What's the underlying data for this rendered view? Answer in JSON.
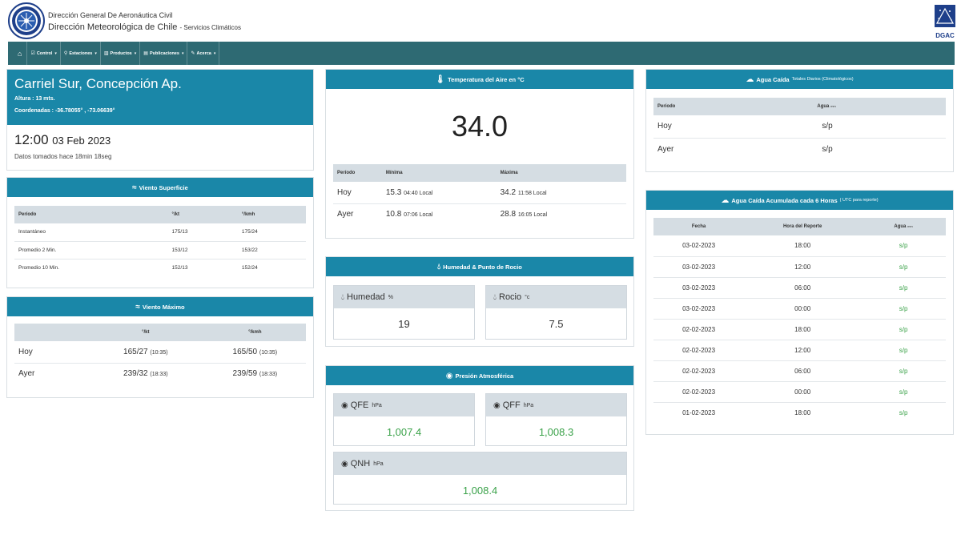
{
  "header": {
    "org_line1": "Dirección General De Aeronáutica Civil",
    "org_line2": "Dirección Meteorológica de Chile",
    "org_line2_sub": "- Servicios Climáticos",
    "right_logo_text": "DGAC"
  },
  "nav": {
    "items": [
      {
        "label": "Control",
        "icon": "checkbox-icon"
      },
      {
        "label": "Estaciones",
        "icon": "map-pin-icon"
      },
      {
        "label": "Productos",
        "icon": "bar-chart-icon"
      },
      {
        "label": "Publicaciones",
        "icon": "document-icon"
      },
      {
        "label": "Acerca",
        "icon": "edit-icon"
      }
    ]
  },
  "station": {
    "name": "Carriel Sur, Concepción Ap.",
    "altura": "Altura : 13 mts.",
    "coords": "Coordenadas : -36.78055° , -73.06639°",
    "time": "12:00",
    "date": "03 Feb 2023",
    "age": "Datos tomados hace 18min 18seg"
  },
  "viento_superficie": {
    "title": "Viento Superficie",
    "headers": [
      "Período",
      "°/kt",
      "°/kmh"
    ],
    "rows": [
      [
        "Instantáneo",
        "175/13",
        "175/24"
      ],
      [
        "Promedio 2 Min.",
        "153/12",
        "153/22"
      ],
      [
        "Promedio 10 Min.",
        "152/13",
        "152/24"
      ]
    ]
  },
  "viento_maximo": {
    "title": "Viento Máximo",
    "headers": [
      "",
      "°/kt",
      "°/kmh"
    ],
    "rows": [
      {
        "label": "Hoy",
        "kt": "165/27",
        "kt_time": "(10:35)",
        "kmh": "165/50",
        "kmh_time": "(10:35)"
      },
      {
        "label": "Ayer",
        "kt": "239/32",
        "kt_time": "(18:33)",
        "kmh": "239/59",
        "kmh_time": "(18:33)"
      }
    ]
  },
  "temperatura": {
    "title": "Temperatura del Aire en °C",
    "current": "34.0",
    "headers": [
      "Período",
      "Mínima",
      "Máxima"
    ],
    "rows": [
      {
        "label": "Hoy",
        "min": "15.3",
        "min_time": "04:40 Local",
        "max": "34.2",
        "max_time": "11:58 Local"
      },
      {
        "label": "Ayer",
        "min": "10.8",
        "min_time": "07:06 Local",
        "max": "28.8",
        "max_time": "16:05 Local"
      }
    ]
  },
  "humedad": {
    "title": "Humedad & Punto de Rocio",
    "humedad_label": "Humedad",
    "humedad_unit": "%",
    "humedad_value": "19",
    "rocio_label": "Rocio",
    "rocio_unit": "°c",
    "rocio_value": "7.5"
  },
  "presion": {
    "title": "Presión Atmosférica",
    "qfe_label": "QFE",
    "qfe_unit": "hPa",
    "qfe_value": "1,007.4",
    "qff_label": "QFF",
    "qff_unit": "hPa",
    "qff_value": "1,008.3",
    "qnh_label": "QNH",
    "qnh_unit": "hPa",
    "qnh_value": "1,008.4"
  },
  "agua_caida": {
    "title": "Agua Caída",
    "subtitle": "Totales Diarios (Climatológicos)",
    "headers": [
      "Período",
      "Agua",
      "mm"
    ],
    "rows": [
      [
        "Hoy",
        "s/p"
      ],
      [
        "Ayer",
        "s/p"
      ]
    ]
  },
  "agua_acumulada": {
    "title": "Agua Caída Acumulada cada 6 Horas",
    "subtitle": "( UTC para reporte)",
    "headers": [
      "Fecha",
      "Hora del Reporte",
      "Agua",
      "mm"
    ],
    "rows": [
      [
        "03-02-2023",
        "18:00",
        "s/p"
      ],
      [
        "03-02-2023",
        "12:00",
        "s/p"
      ],
      [
        "03-02-2023",
        "06:00",
        "s/p"
      ],
      [
        "03-02-2023",
        "00:00",
        "s/p"
      ],
      [
        "02-02-2023",
        "18:00",
        "s/p"
      ],
      [
        "02-02-2023",
        "12:00",
        "s/p"
      ],
      [
        "02-02-2023",
        "06:00",
        "s/p"
      ],
      [
        "02-02-2023",
        "00:00",
        "s/p"
      ],
      [
        "01-02-2023",
        "18:00",
        "s/p"
      ]
    ]
  },
  "colors": {
    "nav_bg": "#2e6a73",
    "card_header": "#1a87a8",
    "value_green": "#3ba24a"
  }
}
